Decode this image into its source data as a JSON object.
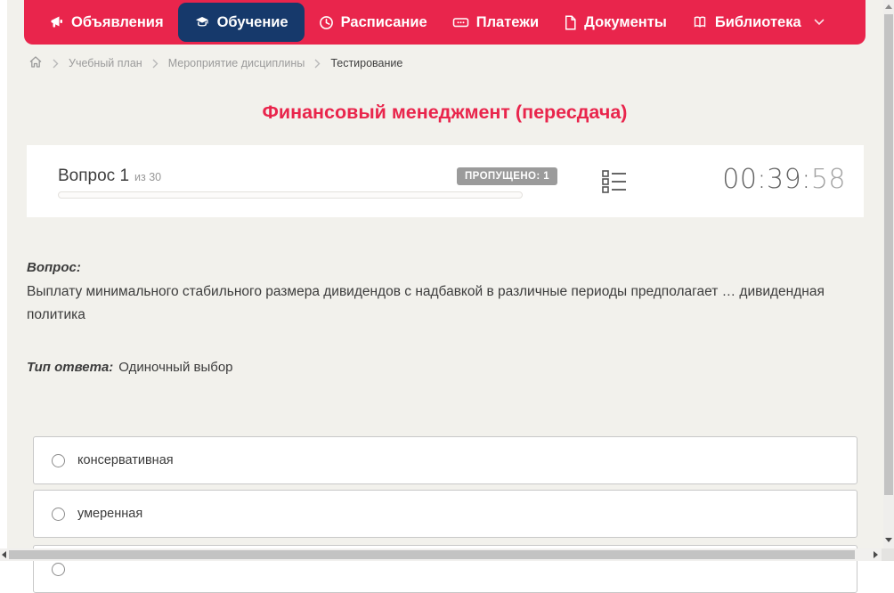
{
  "colors": {
    "nav_red": "#e9254c",
    "active_navy": "#16396b",
    "title_red": "#e9254c",
    "badge_gray": "#9b9b9b",
    "background_cream": "#f2f1ec"
  },
  "nav": {
    "items": [
      {
        "label": "Объявления",
        "icon": "megaphone-icon",
        "active": false
      },
      {
        "label": "Обучение",
        "icon": "graduation-cap-icon",
        "active": true
      },
      {
        "label": "Расписание",
        "icon": "clock-icon",
        "active": false
      },
      {
        "label": "Платежи",
        "icon": "payments-icon",
        "active": false
      },
      {
        "label": "Документы",
        "icon": "document-icon",
        "active": false
      },
      {
        "label": "Библиотека",
        "icon": "book-icon",
        "active": false,
        "has_dropdown": true
      }
    ]
  },
  "breadcrumb": {
    "home_icon": "home-icon",
    "items": [
      "Учебный план",
      "Мероприятие дисциплины",
      "Тестирование"
    ]
  },
  "page": {
    "title": "Финансовый менеджмент (пересдача)"
  },
  "question_card": {
    "question_label": "Вопрос 1",
    "of_label": "из 30",
    "skipped_badge": "ПРОПУЩЕНО: 1",
    "progress_percent": 0,
    "timer": {
      "main": "00:39:",
      "seconds": "58"
    }
  },
  "question": {
    "prompt_label": "Вопрос:",
    "text": "Выплату минимального стабильного размера дивидендов с надбавкой в различные периоды предполагает … дивидендная политика",
    "answer_type_label": "Тип ответа:",
    "answer_type": "Одиночный выбор"
  },
  "options": [
    {
      "label": "консервативная"
    },
    {
      "label": "умеренная"
    },
    {
      "label": ""
    }
  ]
}
